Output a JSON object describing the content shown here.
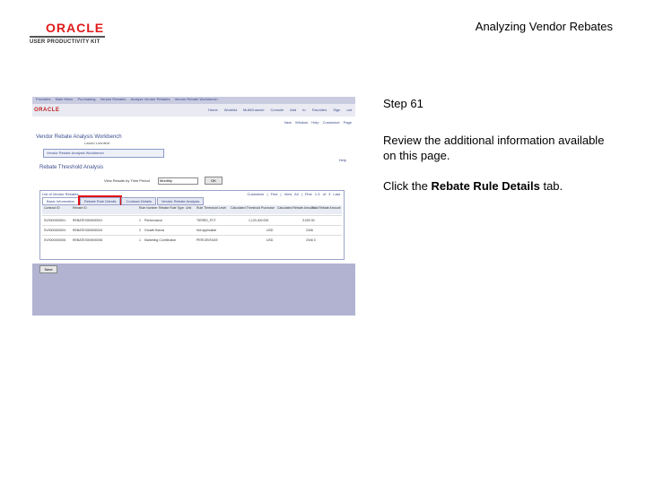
{
  "header": {
    "brand": "ORACLE",
    "brand_sub": "USER PRODUCTIVITY KIT",
    "doc_title": "Analyzing Vendor Rebates"
  },
  "screenshot": {
    "nav_links": [
      "Favorites",
      "Main Menu",
      "Purchasing",
      "Vendor Rebates",
      "Analyze Vendor Rebates",
      "Vendor Rebate Workbench"
    ],
    "brand_logo": "ORACLE",
    "top_links": "Home  Worklist  MultiChannel Console  Add to Favorites  Sign out",
    "util_links": "New Window  Help  Customize Page",
    "workbench_title": "Vendor Rebate Analysis Workbench",
    "workbench_sub": "Laszlo Lorinfeld",
    "nav_box": "Vendor Rebate Analysis Workbench",
    "help_link": "Help",
    "section_title": "Rebate Threshold Analysis",
    "filter_label": "View Results by Time Period",
    "filter_value": "Monthly",
    "ok_label": "OK",
    "grid_head": "List of Vendor Rebates",
    "grid_nav": "Customize | Find | View All | First 1-3 of 3 Last",
    "tabs": [
      "Basic Information",
      "Rebate Rule Details",
      "Contract Details",
      "Vendor Rebate Analysis"
    ],
    "columns": [
      "Contract ID",
      "Rebate ID",
      "Rule Number",
      "Rebate Rule Type",
      "Unit",
      "Rule Threshold Level",
      "Calculated Threshold Purchase",
      "Calculated Rebate Amount",
      "Total Rebate Amount"
    ],
    "rows": [
      [
        "SV0000000001",
        "REBATE0000000001",
        "1",
        "Performance",
        "",
        "TIERED_PCT",
        "1,120,400.000",
        "3,000.00",
        ""
      ],
      [
        "SV0000000004",
        "REBATE0000000004",
        "2",
        "Growth Bonus",
        "",
        "Not applicable",
        "USD",
        "2346",
        ""
      ],
      [
        "SV0000000006",
        "REBATE0000000006",
        "1",
        "Marketing Contribution",
        "",
        "PERCENTAGE",
        "USD",
        "2346 0",
        ""
      ]
    ],
    "save_label": "Save"
  },
  "step": {
    "label": "Step 61",
    "review_text": "Review the additional information available on this page.",
    "click_prefix": "Click the ",
    "click_target": "Rebate Rule Details",
    "click_suffix": " tab."
  }
}
